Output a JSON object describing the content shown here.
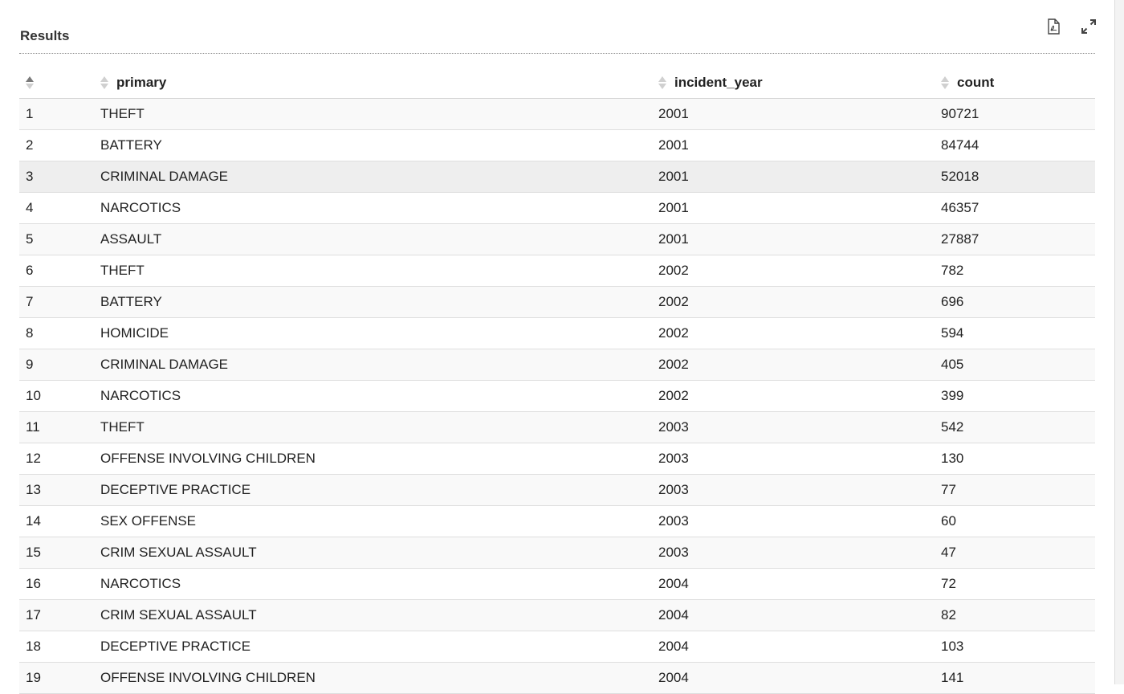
{
  "panel": {
    "title": "Results",
    "icons": [
      "pdf-export-icon",
      "expand-icon"
    ]
  },
  "table": {
    "columns": [
      "",
      "primary",
      "incident_year",
      "count"
    ],
    "rows": [
      {
        "idx": "1",
        "primary": "THEFT",
        "incident_year": "2001",
        "count": "90721"
      },
      {
        "idx": "2",
        "primary": "BATTERY",
        "incident_year": "2001",
        "count": "84744"
      },
      {
        "idx": "3",
        "primary": "CRIMINAL DAMAGE",
        "incident_year": "2001",
        "count": "52018"
      },
      {
        "idx": "4",
        "primary": "NARCOTICS",
        "incident_year": "2001",
        "count": "46357"
      },
      {
        "idx": "5",
        "primary": "ASSAULT",
        "incident_year": "2001",
        "count": "27887"
      },
      {
        "idx": "6",
        "primary": "THEFT",
        "incident_year": "2002",
        "count": "782"
      },
      {
        "idx": "7",
        "primary": "BATTERY",
        "incident_year": "2002",
        "count": "696"
      },
      {
        "idx": "8",
        "primary": "HOMICIDE",
        "incident_year": "2002",
        "count": "594"
      },
      {
        "idx": "9",
        "primary": "CRIMINAL DAMAGE",
        "incident_year": "2002",
        "count": "405"
      },
      {
        "idx": "10",
        "primary": "NARCOTICS",
        "incident_year": "2002",
        "count": "399"
      },
      {
        "idx": "11",
        "primary": "THEFT",
        "incident_year": "2003",
        "count": "542"
      },
      {
        "idx": "12",
        "primary": "OFFENSE INVOLVING CHILDREN",
        "incident_year": "2003",
        "count": "130"
      },
      {
        "idx": "13",
        "primary": "DECEPTIVE PRACTICE",
        "incident_year": "2003",
        "count": "77"
      },
      {
        "idx": "14",
        "primary": "SEX OFFENSE",
        "incident_year": "2003",
        "count": "60"
      },
      {
        "idx": "15",
        "primary": "CRIM SEXUAL ASSAULT",
        "incident_year": "2003",
        "count": "47"
      },
      {
        "idx": "16",
        "primary": "NARCOTICS",
        "incident_year": "2004",
        "count": "72"
      },
      {
        "idx": "17",
        "primary": "CRIM SEXUAL ASSAULT",
        "incident_year": "2004",
        "count": "82"
      },
      {
        "idx": "18",
        "primary": "DECEPTIVE PRACTICE",
        "incident_year": "2004",
        "count": "103"
      },
      {
        "idx": "19",
        "primary": "OFFENSE INVOLVING CHILDREN",
        "incident_year": "2004",
        "count": "141"
      }
    ]
  },
  "colors": {
    "row_odd": "#f9f9f9",
    "row_even": "#ffffff",
    "row_hover": "#eeeeee",
    "divider": "#dedede"
  }
}
